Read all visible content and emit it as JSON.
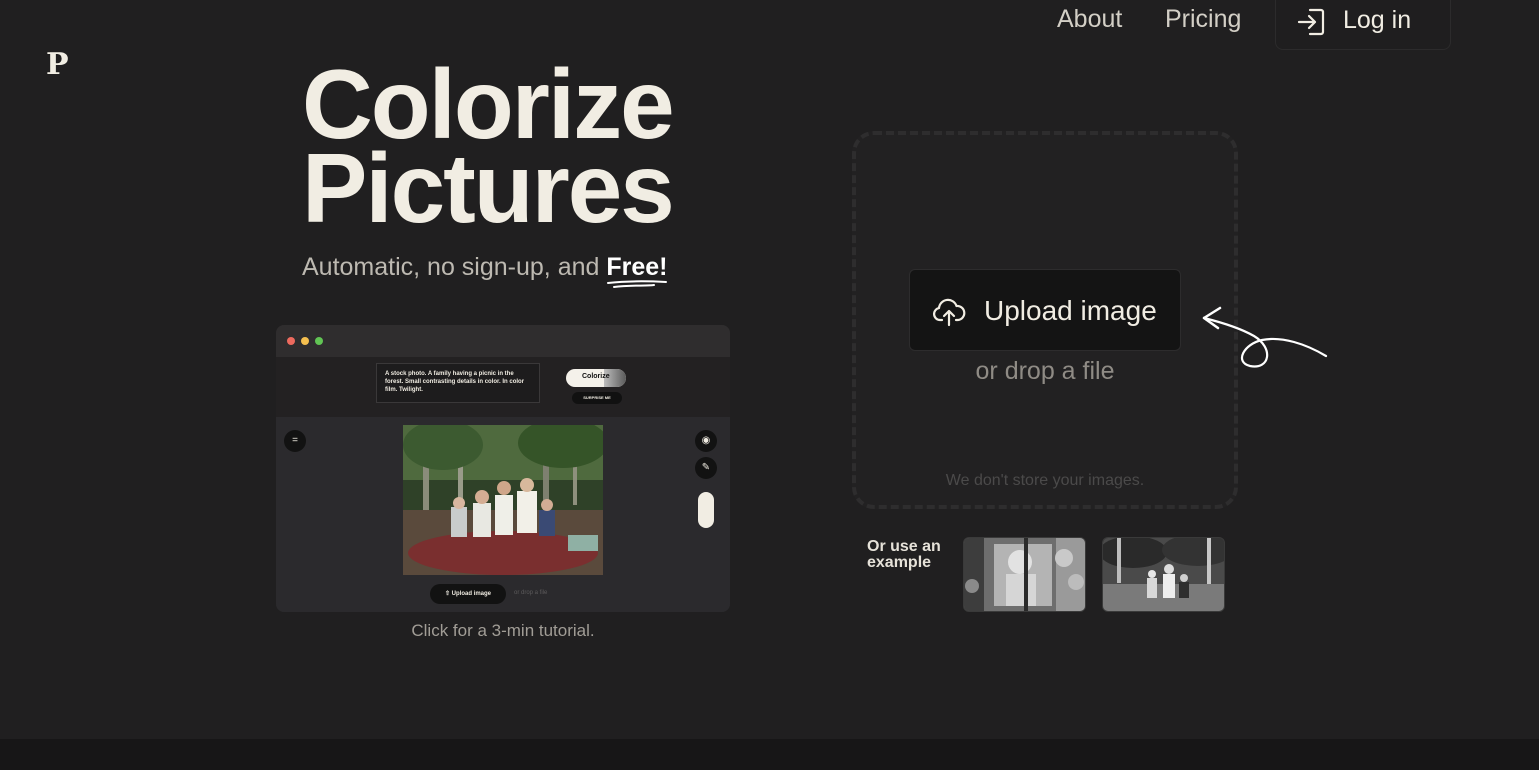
{
  "brand": {
    "logo": "P"
  },
  "nav": {
    "about": "About",
    "pricing": "Pricing",
    "login": "Log in"
  },
  "hero": {
    "title_line1": "Colorize",
    "title_line2": "Pictures",
    "subtitle_prefix": "Automatic, no sign-up, and ",
    "subtitle_emphasis": "Free!"
  },
  "tutorial": {
    "prompt_text": "A stock photo. A family having a picnic in the forest. Small contrasting details in color. In color film. Twilight.",
    "colorize_label": "Colorize",
    "surprise_label": "SURPRISE ME",
    "upload_label": "Upload image",
    "drop_label": "or drop a file",
    "caption": "Click for a 3-min tutorial."
  },
  "uploader": {
    "upload_label": "Upload image",
    "drop_label": "or drop a file",
    "privacy_note": "We don't store your images."
  },
  "examples": {
    "label": "Or use an example",
    "items": [
      {
        "icon": "vintage-portrait-photo"
      },
      {
        "icon": "vintage-picnic-photo"
      }
    ]
  },
  "colors": {
    "background": "#201f20",
    "title": "#f1ede3",
    "button": "#141414",
    "window_dots": [
      "#ed6a5e",
      "#f5bf4f",
      "#61c454"
    ]
  }
}
